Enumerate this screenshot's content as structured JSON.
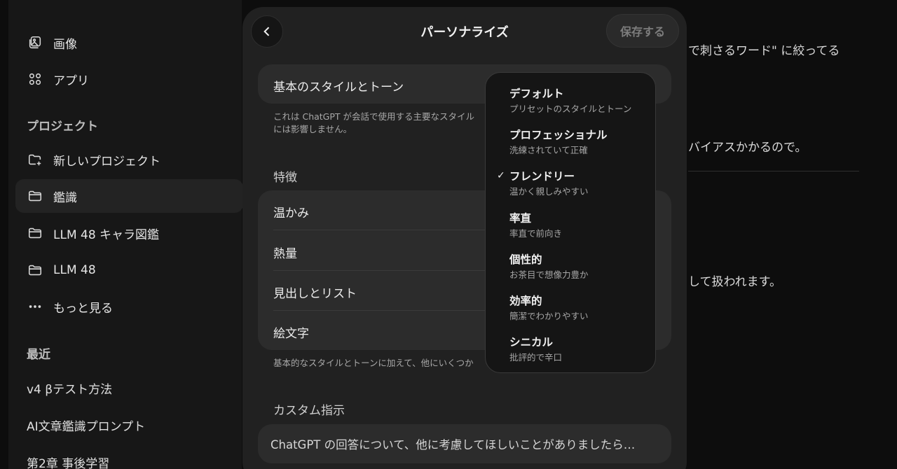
{
  "sidebar": {
    "top_items": [
      {
        "label": "画像",
        "icon": "image-icon"
      },
      {
        "label": "アプリ",
        "icon": "apps-icon"
      }
    ],
    "projects_heading": "プロジェクト",
    "projects": [
      {
        "label": "新しいプロジェクト",
        "icon": "new-folder-icon"
      },
      {
        "label": "鑑識",
        "icon": "folder-icon"
      },
      {
        "label": "LLM 48 キャラ図鑑",
        "icon": "folder-icon"
      },
      {
        "label": "LLM 48",
        "icon": "folder-icon"
      }
    ],
    "more_label": "もっと見る",
    "recent_heading": "最近",
    "recent": [
      "v4 βテスト方法",
      "AI文章鑑識プロンプト",
      "第2章 事後学習"
    ]
  },
  "background_chat": {
    "line1": "で刺さるワード\" に絞ってる",
    "line2": "バイアスかかるので。",
    "line3": "して扱われます。"
  },
  "modal": {
    "title": "パーソナライズ",
    "save_label": "保存する",
    "base_style": {
      "label": "基本のスタイルとトーン",
      "desc_line1": "これは ChatGPT が会話で使用する主要なスタイル",
      "desc_line2": "には影響しません。"
    },
    "traits": {
      "heading": "特徴",
      "rows": [
        "温かみ",
        "熱量",
        "見出しとリスト",
        "絵文字"
      ],
      "desc": "基本的なスタイルとトーンに加えて、他にいくつか"
    },
    "custom": {
      "heading": "カスタム指示",
      "placeholder": "ChatGPT の回答について、他に考慮してほしいことがありましたら…"
    }
  },
  "dropdown": {
    "selected_index": 2,
    "options": [
      {
        "label": "デフォルト",
        "sub": "プリセットのスタイルとトーン"
      },
      {
        "label": "プロフェッショナル",
        "sub": "洗練されていて正確"
      },
      {
        "label": "フレンドリー",
        "sub": "温かく親しみやすい"
      },
      {
        "label": "率直",
        "sub": "率直で前向き"
      },
      {
        "label": "個性的",
        "sub": "お茶目で想像力豊か"
      },
      {
        "label": "効率的",
        "sub": "簡潔でわかりやすい"
      },
      {
        "label": "シニカル",
        "sub": "批評的で辛口"
      }
    ]
  }
}
